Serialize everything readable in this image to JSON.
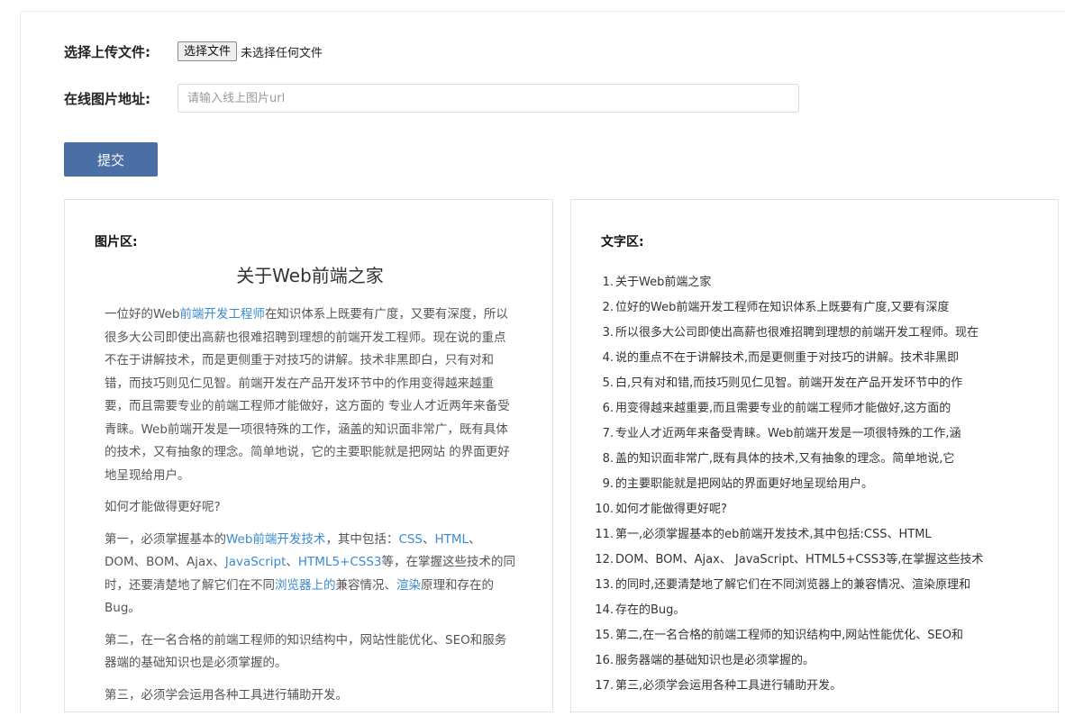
{
  "form": {
    "upload_label": "选择上传文件:",
    "file_button": "选择文件",
    "file_status": "未选择任何文件",
    "url_label": "在线图片地址:",
    "url_placeholder": "请输入线上图片url",
    "url_value": "",
    "submit_label": "提交"
  },
  "image_panel": {
    "title": "图片区:",
    "image_heading": "关于Web前端之家",
    "paragraphs": [
      [
        {
          "t": "一位好的Web"
        },
        {
          "t": "前端开发工程师",
          "hl": true
        },
        {
          "t": "在知识体系上既要有广度，又要有深度，所以很多大公司即使出高薪也很难招聘到理想的前端开发工程师。现在说的重点不在于讲解技术，而是更侧重于对技巧的讲解。技术非黑即白，只有对和错，而技巧则见仁见智。前端开发在产品开发环节中的作用变得越来越重要，而且需要专业的前端工程师才能做好，这方面的 专业人才近两年来备受青睐。Web前端开发是一项很特殊的工作，涵盖的知识面非常广，既有具体的技术，又有抽象的理念。简单地说，它的主要职能就是把网站 的界面更好地呈现给用户。"
        }
      ],
      [
        {
          "t": "如何才能做得更好呢?"
        }
      ],
      [
        {
          "t": "第一，必须掌握基本的"
        },
        {
          "t": "Web前端开发技术",
          "hl": true
        },
        {
          "t": "，其中包括："
        },
        {
          "t": "CSS",
          "hl": true
        },
        {
          "t": "、"
        },
        {
          "t": "HTML",
          "hl": true
        },
        {
          "t": "、DOM、BOM、Ajax、"
        },
        {
          "t": "JavaScript",
          "hl": true
        },
        {
          "t": "、"
        },
        {
          "t": "HTML5+CSS3",
          "hl": true
        },
        {
          "t": "等，在掌握这些技术的同时，还要清楚地了解它们在不同"
        },
        {
          "t": "浏览器上的",
          "hl": true
        },
        {
          "t": "兼容情况、"
        },
        {
          "t": "渲染",
          "hl": true
        },
        {
          "t": "原理和存在的Bug。"
        }
      ],
      [
        {
          "t": "第二，在一名合格的前端工程师的知识结构中，网站性能优化、SEO和服务器端的基础知识也是必须掌握的。"
        }
      ],
      [
        {
          "t": "第三，必须学会运用各种工具进行辅助开发。"
        }
      ]
    ]
  },
  "text_panel": {
    "title": "文字区:",
    "lines": [
      "关于Web前端之家",
      "位好的Web前端开发工程师在知识体系上既要有广度,又要有深度",
      "所以很多大公司即使出高薪也很难招聘到理想的前端开发工程师。现在",
      "说的重点不在于讲解技术,而是更侧重于对技巧的讲解。技术非黑即",
      "白,只有对和错,而技巧则见仁见智。前端开发在产品开发环节中的作",
      "用变得越来越重要,而且需要专业的前端工程师才能做好,这方面的",
      "专业人才近两年来备受青睐。Web前端开发是一项很特殊的工作,涵",
      "盖的知识面非常广,既有具体的技术,又有抽象的理念。简单地说,它",
      "的主要职能就是把网站的界面更好地呈现给用户。",
      "如何才能做得更好呢?",
      "第一,必须掌握基本的eb前端开发技术,其中包括:CSS、HTML",
      "DOM、BOM、Ajax、 JavaScript、HTML5+CSS3等,在掌握这些技术",
      "的同时,还要清楚地了解它们在不同浏览器上的兼容情况、渲染原理和",
      "存在的Bug。",
      "第二,在一名合格的前端工程师的知识结构中,网站性能优化、SEO和",
      "服务器端的基础知识也是必须掌握的。",
      "第三,必须学会运用各种工具进行辅助开发。"
    ]
  }
}
